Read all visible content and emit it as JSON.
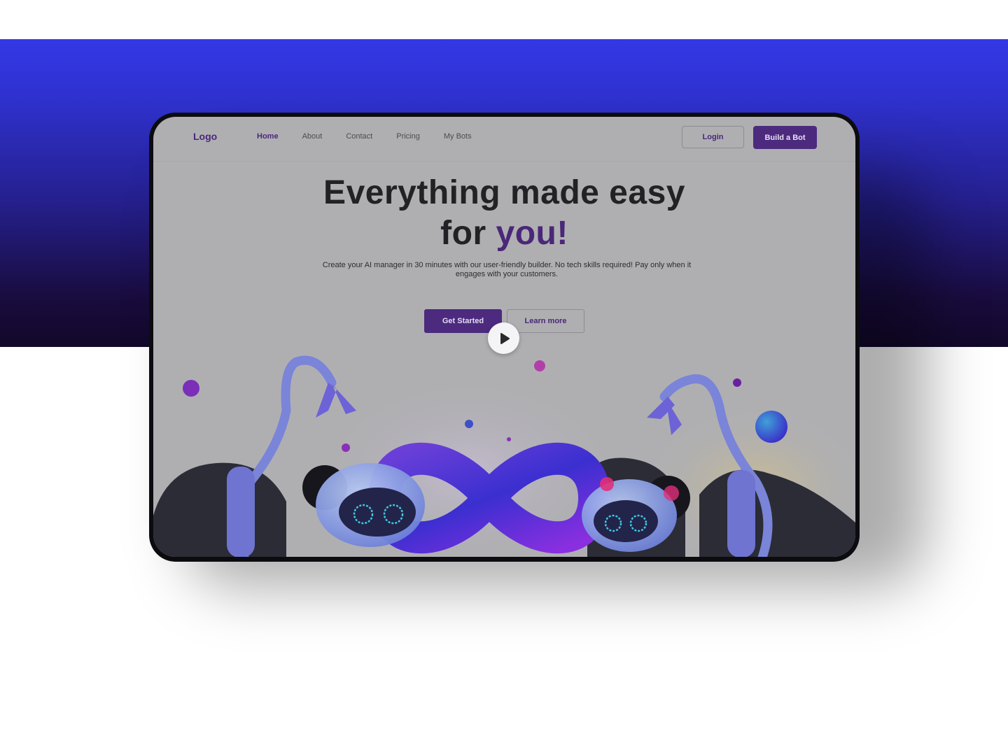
{
  "nav": {
    "logo": "Logo",
    "items": [
      {
        "label": "Home",
        "active": true
      },
      {
        "label": "About",
        "active": false
      },
      {
        "label": "Contact",
        "active": false
      },
      {
        "label": "Pricing",
        "active": false
      },
      {
        "label": "My Bots",
        "active": false
      }
    ],
    "login_label": "Login",
    "build_label": "Build a Bot"
  },
  "hero": {
    "title_line1": "Everything made easy",
    "title_line2_prefix": "for ",
    "title_line2_accent": "you!",
    "subtitle": "Create your AI manager in 30 minutes with our user-friendly builder. No tech skills required! Pay only when it engages with your customers.",
    "primary_cta": "Get Started",
    "secondary_cta": "Learn more"
  },
  "media": {
    "play_icon": "play-icon",
    "illustration": "robots-infinity-illustration"
  },
  "colors": {
    "brand": "#4c2a7e",
    "backdrop_top": "#3338e6",
    "backdrop_bottom": "#12082a",
    "screen_bg": "#afafb2"
  }
}
